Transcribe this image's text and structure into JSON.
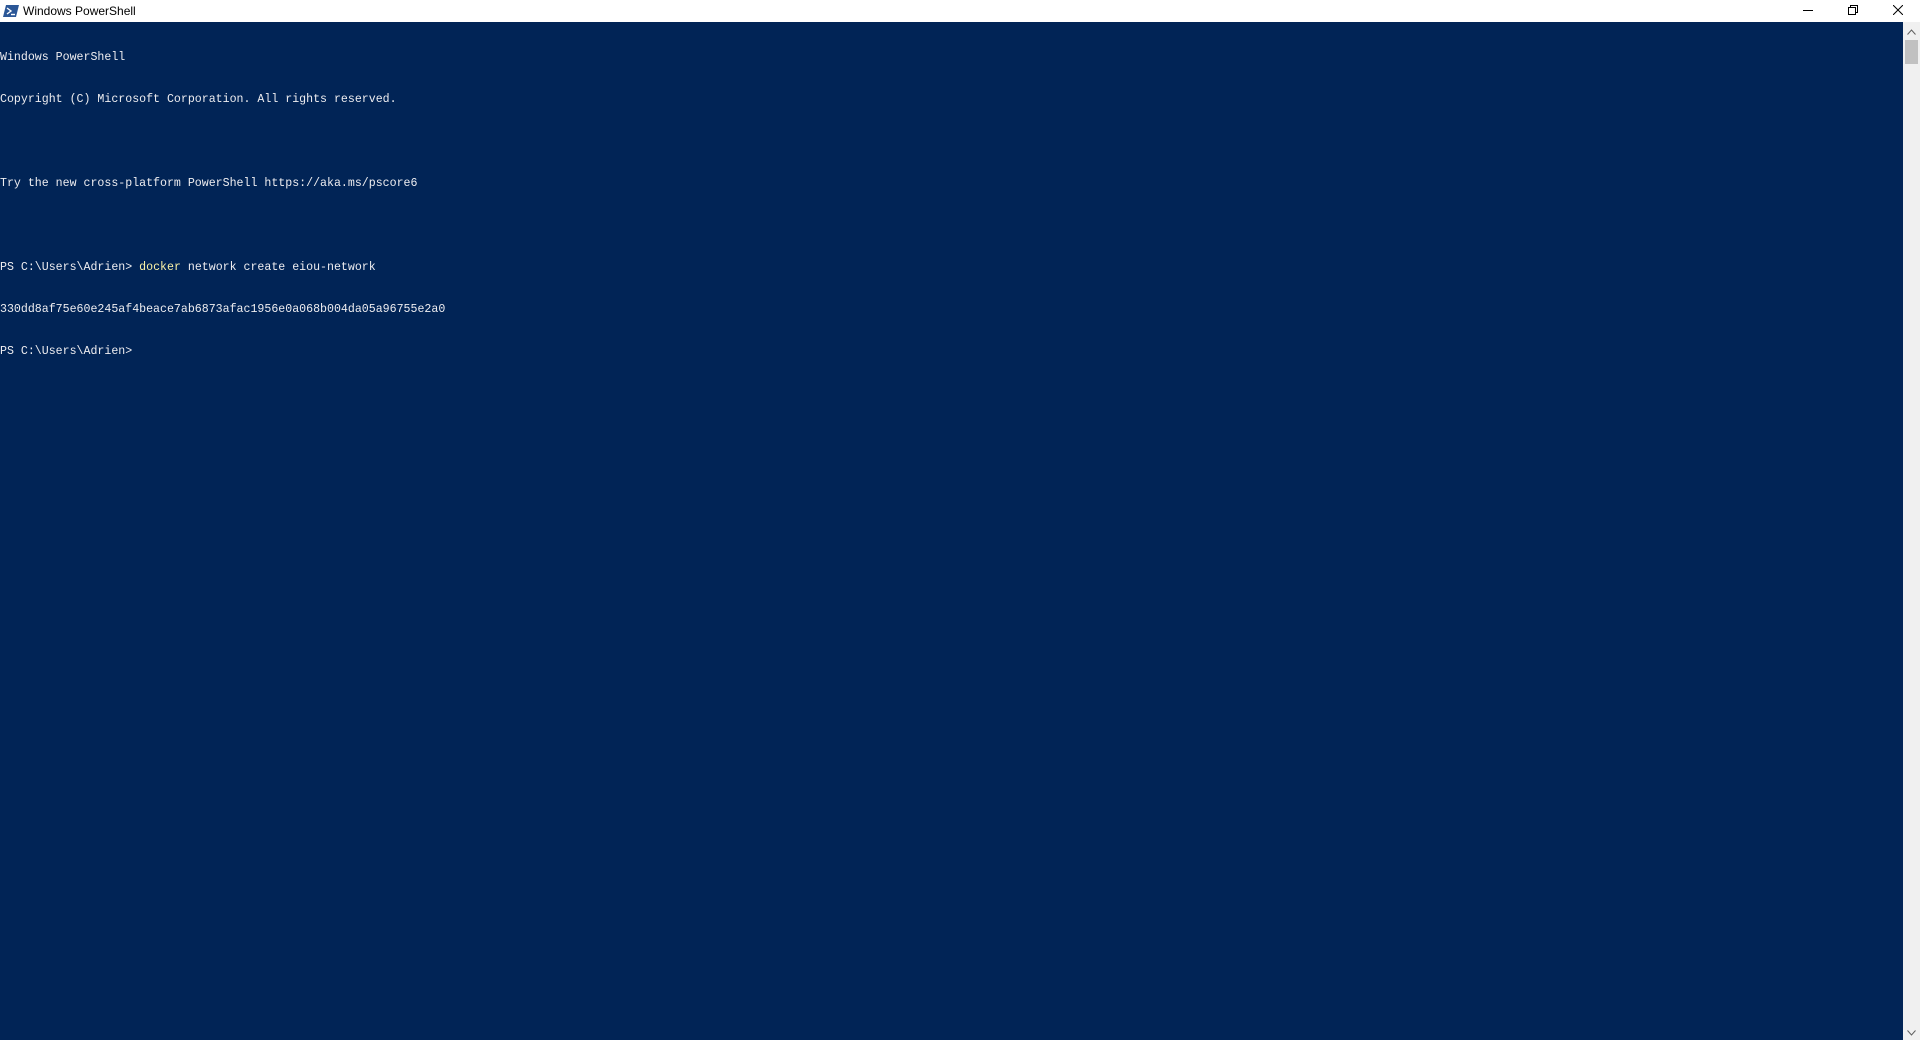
{
  "window": {
    "title": "Windows PowerShell"
  },
  "icons": {
    "app": "powershell-icon",
    "minimize": "minimize-icon",
    "restore": "restore-icon",
    "close": "close-icon"
  },
  "colors": {
    "console_bg": "#012456",
    "console_fg": "#eeedf0",
    "command": "#f9f1a5"
  },
  "console": {
    "header1": "Windows PowerShell",
    "header2": "Copyright (C) Microsoft Corporation. All rights reserved.",
    "header3": "Try the new cross-platform PowerShell https://aka.ms/pscore6",
    "prompt1": "PS C:\\Users\\Adrien> ",
    "command1": "docker",
    "command1_args": " network create eiou-network",
    "output1": "330dd8af75e60e245af4beace7ab6873afac1956e0a068b004da05a96755e2a0",
    "prompt2": "PS C:\\Users\\Adrien>"
  }
}
